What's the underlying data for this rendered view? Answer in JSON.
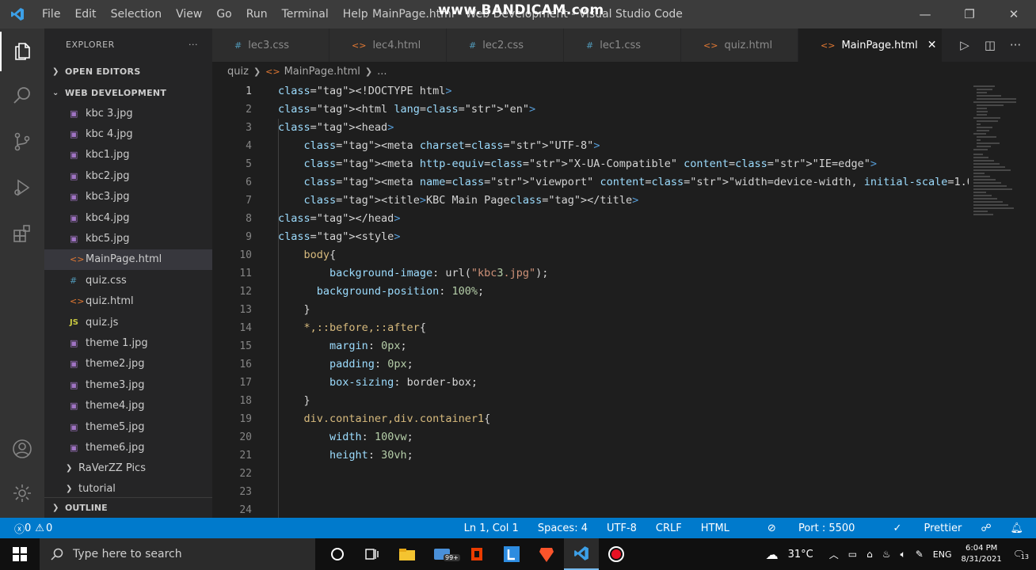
{
  "titlebar": {
    "menu": [
      "File",
      "Edit",
      "Selection",
      "View",
      "Go",
      "Run",
      "Terminal",
      "Help"
    ],
    "title": "MainPage.html - Web Development - Visual Studio Code",
    "watermark": "www.BANDICAM.com"
  },
  "sidebar": {
    "header": "EXPLORER",
    "more": "···",
    "open_editors": "OPEN EDITORS",
    "workspace": "WEB DEVELOPMENT",
    "files": [
      {
        "name": "kbc 3.jpg",
        "icon": "image-icon"
      },
      {
        "name": "kbc 4.jpg",
        "icon": "image-icon"
      },
      {
        "name": "kbc1.jpg",
        "icon": "image-icon"
      },
      {
        "name": "kbc2.jpg",
        "icon": "image-icon"
      },
      {
        "name": "kbc3.jpg",
        "icon": "image-icon"
      },
      {
        "name": "kbc4.jpg",
        "icon": "image-icon"
      },
      {
        "name": "kbc5.jpg",
        "icon": "image-icon"
      },
      {
        "name": "MainPage.html",
        "icon": "html-icon"
      },
      {
        "name": "quiz.css",
        "icon": "css-icon"
      },
      {
        "name": "quiz.html",
        "icon": "html-icon"
      },
      {
        "name": "quiz.js",
        "icon": "js-icon"
      },
      {
        "name": "theme 1.jpg",
        "icon": "image-icon"
      },
      {
        "name": "theme2.jpg",
        "icon": "image-icon"
      },
      {
        "name": "theme3.jpg",
        "icon": "image-icon"
      },
      {
        "name": "theme4.jpg",
        "icon": "image-icon"
      },
      {
        "name": "theme5.jpg",
        "icon": "image-icon"
      },
      {
        "name": "theme6.jpg",
        "icon": "image-icon"
      }
    ],
    "folders": [
      "RaVerZZ Pics",
      "tutorial"
    ],
    "outline": "OUTLINE"
  },
  "tabs": [
    {
      "label": "lec3.css",
      "icon": "#"
    },
    {
      "label": "lec4.html",
      "icon": "<>"
    },
    {
      "label": "lec2.css",
      "icon": "#"
    },
    {
      "label": "lec1.css",
      "icon": "#"
    },
    {
      "label": "quiz.html",
      "icon": "<>"
    },
    {
      "label": "MainPage.html",
      "icon": "<>",
      "active": true
    }
  ],
  "breadcrumb": {
    "folder": "quiz",
    "file": "MainPage.html",
    "more": "..."
  },
  "editor": {
    "line_numbers": [
      "1",
      "2",
      "3",
      "4",
      "5",
      "6",
      "7",
      "8",
      "9",
      "10",
      "11",
      "12",
      "13",
      "14",
      "15",
      "16",
      "17",
      "18",
      "19",
      "20",
      "21",
      "22",
      "23",
      "24"
    ],
    "lines": [
      "<!DOCTYPE html>",
      "<html lang=\"en\">",
      "<head>",
      "    <meta charset=\"UTF-8\">",
      "    <meta http-equiv=\"X-UA-Compatible\" content=\"IE=edge\">",
      "    <meta name=\"viewport\" content=\"width=device-width, initial-scale=1.0\">",
      "    <title>KBC Main Page</title>",
      "</head>",
      "<style>",
      "    body{",
      "        background-image: url(\"kbc3.jpg\");",
      "      background-position: 100%;",
      "    }",
      "    *,::before,::after{",
      "        margin: 0px;",
      "        padding: 0px;",
      "        box-sizing: border-box;",
      "    }",
      "    div.container,div.container1{",
      "        width: 100vw;",
      "        height: 30vh;",
      "",
      "",
      ""
    ]
  },
  "statusbar": {
    "errors": "0",
    "warnings": "0",
    "position": "Ln 1, Col 1",
    "spaces": "Spaces: 4",
    "encoding": "UTF-8",
    "eol": "CRLF",
    "language": "HTML",
    "port": "Port : 5500",
    "prettier": "Prettier"
  },
  "taskbar": {
    "search_placeholder": "Type here to search",
    "temperature": "31°C",
    "language": "ENG",
    "time": "6:04 PM",
    "date": "8/31/2021",
    "mail_badge": "99+",
    "notification_count": "13"
  },
  "colors": {
    "statusbar": "#007acc",
    "titlebar": "#3c3c3c",
    "activitybar": "#333333",
    "sidebar": "#252526",
    "editor": "#1e1e1e"
  }
}
